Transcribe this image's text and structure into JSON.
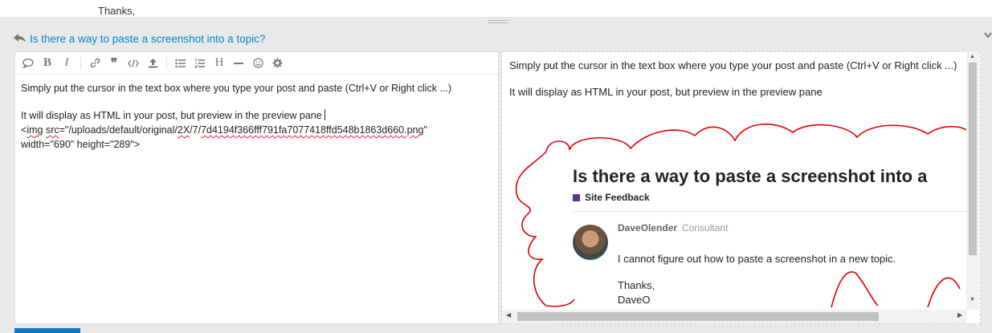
{
  "top": {
    "trailing_text": "Thanks,"
  },
  "reply": {
    "topic_title": "Is there a way to paste a screenshot into a topic?"
  },
  "toolbar": {
    "buttons": [
      "quote",
      "bold",
      "italic",
      "link",
      "blockquote",
      "code",
      "upload",
      "bullet-list",
      "numbered-list",
      "heading",
      "horizontal-rule",
      "emoji",
      "options"
    ],
    "bold_label": "B",
    "italic_label": "I",
    "heading_label": "H",
    "quote_label": "❞"
  },
  "editor": {
    "line1": "Simply put the cursor in the text box where you type your post and paste (Ctrl+V or Right click ...)",
    "line2": "It will display as HTML in your post, but preview in the preview pane",
    "line3_pre": "<",
    "line3_tag": "img",
    "line3_mid": " ",
    "line3_attr": "src",
    "line3_eq": "=\"/uploads/default/original/",
    "line3_dir": "2X",
    "line3_path": "/7/",
    "line3_file": "7d4194f366fff791fa7077418ffd548b1863d660.png",
    "line3_end": "\"",
    "line4": "width=\"690\" height=\"289\">"
  },
  "preview": {
    "para1": "Simply put the cursor in the text box where you type your post and paste (Ctrl+V or Right click ...)",
    "para2": "It will display as HTML in your post, but preview in the preview pane",
    "screenshot": {
      "title": "Is there a way to paste a screenshot into a",
      "category": "Site Feedback",
      "category_color": "#652d90",
      "author": "DaveOlender",
      "author_title": "Consultant",
      "body": "I cannot figure out how to paste a screenshot in a new topic.",
      "sig1": "Thanks,",
      "sig2": "DaveO"
    }
  },
  "colors": {
    "link": "#0088cc",
    "primary_button": "#0e76bd",
    "annotation": "#e00000"
  }
}
